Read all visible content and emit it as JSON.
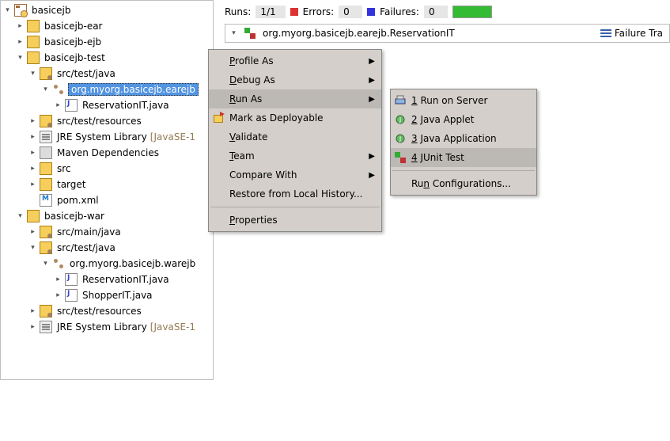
{
  "runbar": {
    "runs_label": "Runs:",
    "runs_value": "1/1",
    "errors_label": "Errors:",
    "errors_value": "0",
    "failures_label": "Failures:",
    "failures_value": "0"
  },
  "crumb": {
    "path": "org.myorg.basicejb.earejb.ReservationIT",
    "failure_trace": "Failure Tra"
  },
  "tree": [
    {
      "d": 0,
      "t": "v",
      "ic": "proj-e",
      "label": "basicejb"
    },
    {
      "d": 1,
      "t": ">",
      "ic": "mod",
      "label": "basicejb-ear"
    },
    {
      "d": 1,
      "t": ">",
      "ic": "mod",
      "label": "basicejb-ejb"
    },
    {
      "d": 1,
      "t": "v",
      "ic": "mod",
      "label": "basicejb-test"
    },
    {
      "d": 2,
      "t": "v",
      "ic": "pkg-folder",
      "label": "src/test/java"
    },
    {
      "d": 3,
      "t": "v",
      "ic": "pkg",
      "label": "org.myorg.basicejb.earejb",
      "selected": true
    },
    {
      "d": 4,
      "t": ">",
      "ic": "java",
      "label": "ReservationIT.java"
    },
    {
      "d": 2,
      "t": ">",
      "ic": "pkg-folder",
      "label": "src/test/resources"
    },
    {
      "d": 2,
      "t": ">",
      "ic": "jre",
      "label": "JRE System Library",
      "extra": "[JavaSE-1"
    },
    {
      "d": 2,
      "t": ">",
      "ic": "jar",
      "label": "Maven Dependencies"
    },
    {
      "d": 2,
      "t": ">",
      "ic": "folder",
      "label": "src"
    },
    {
      "d": 2,
      "t": ">",
      "ic": "folder",
      "label": "target"
    },
    {
      "d": 2,
      "t": " ",
      "ic": "xml",
      "label": "pom.xml"
    },
    {
      "d": 1,
      "t": "v",
      "ic": "mod",
      "label": "basicejb-war"
    },
    {
      "d": 2,
      "t": ">",
      "ic": "pkg-folder",
      "label": "src/main/java"
    },
    {
      "d": 2,
      "t": "v",
      "ic": "pkg-folder",
      "label": "src/test/java"
    },
    {
      "d": 3,
      "t": "v",
      "ic": "pkg",
      "label": "org.myorg.basicejb.warejb"
    },
    {
      "d": 4,
      "t": ">",
      "ic": "java",
      "label": "ReservationIT.java"
    },
    {
      "d": 4,
      "t": ">",
      "ic": "java",
      "label": "ShopperIT.java"
    },
    {
      "d": 2,
      "t": ">",
      "ic": "pkg-folder",
      "label": "src/test/resources"
    },
    {
      "d": 2,
      "t": ">",
      "ic": "jre",
      "label": "JRE System Library",
      "extra": "[JavaSE-1"
    }
  ],
  "context_menu": {
    "items": [
      {
        "label": "Profile As",
        "m": "P",
        "arrow": true
      },
      {
        "label": "Debug As",
        "m": "D",
        "arrow": true
      },
      {
        "label": "Run As",
        "m": "R",
        "arrow": true,
        "hover": true
      },
      {
        "label": "Mark as Deployable",
        "icon": "deploy"
      },
      {
        "label": "Validate",
        "m": "V"
      },
      {
        "label": "Team",
        "m": "T",
        "arrow": true
      },
      {
        "label": "Compare With",
        "m": "",
        "arrow": true
      },
      {
        "label": "Restore from Local History...",
        "m": ""
      },
      {
        "sep": true
      },
      {
        "label": "Properties",
        "m": "P"
      }
    ]
  },
  "submenu": {
    "items": [
      {
        "num": "1",
        "label": "Run on Server",
        "m": "1",
        "icon": "server"
      },
      {
        "num": "2",
        "label": "Java Applet",
        "m": "2",
        "icon": "applet"
      },
      {
        "num": "3",
        "label": "Java Application",
        "m": "3",
        "icon": "japp"
      },
      {
        "num": "4",
        "label": "JUnit Test",
        "m": "4",
        "icon": "junit",
        "hover": true
      },
      {
        "sep": true
      },
      {
        "num": "",
        "label": "Run Configurations...",
        "m": "n"
      }
    ]
  }
}
